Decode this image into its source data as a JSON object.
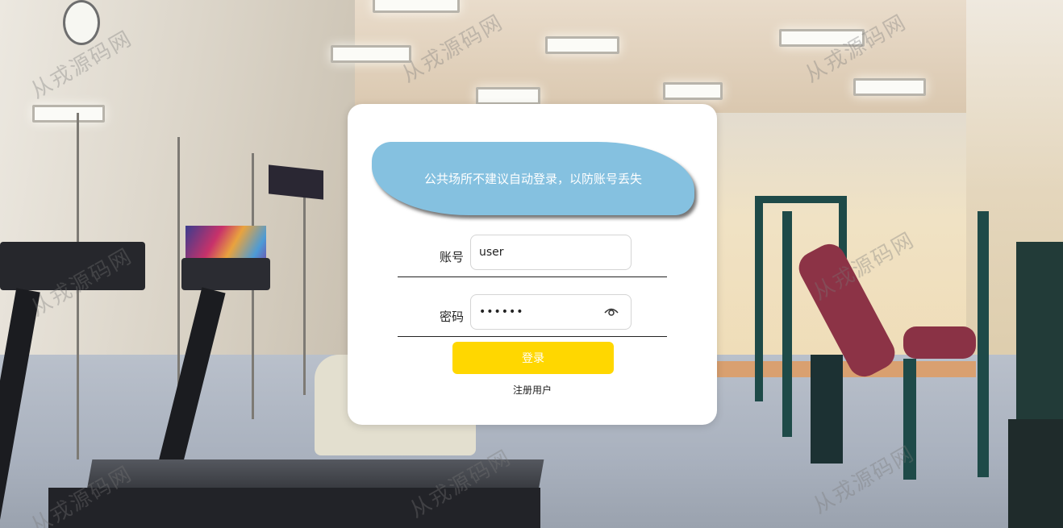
{
  "watermark": {
    "text": "从戎源码网"
  },
  "login": {
    "notice": "公共场所不建议自动登录，以防账号丢失",
    "account_label": "账号",
    "account_value": "user",
    "password_label": "密码",
    "password_value": "••••••",
    "login_button": "登录",
    "register_link": "注册用户"
  },
  "colors": {
    "banner": "#85c1e0",
    "login_button": "#ffd700",
    "card": "#ffffff"
  },
  "icons": {
    "password_toggle": "eye-icon"
  }
}
